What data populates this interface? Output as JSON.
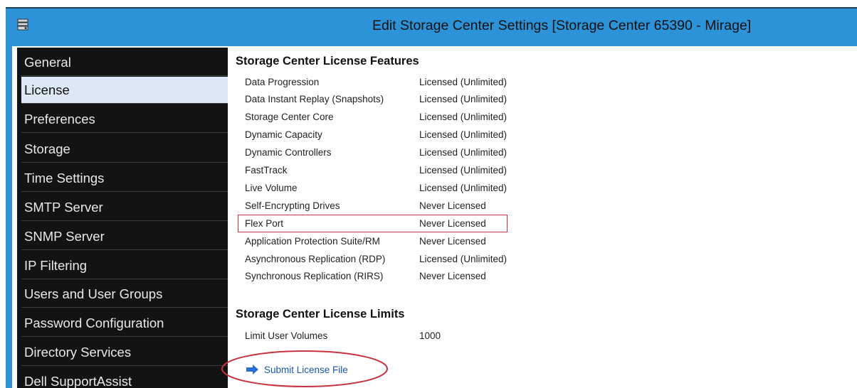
{
  "window": {
    "title": "Edit Storage Center Settings [Storage Center 65390 - Mirage]",
    "icon": "storage-manager-icon"
  },
  "sidebar": {
    "items": [
      {
        "label": "General"
      },
      {
        "label": "License",
        "selected": true
      },
      {
        "label": "Preferences"
      },
      {
        "label": "Storage"
      },
      {
        "label": "Time Settings"
      },
      {
        "label": "SMTP Server"
      },
      {
        "label": "SNMP Server"
      },
      {
        "label": "IP Filtering"
      },
      {
        "label": "Users and User Groups"
      },
      {
        "label": "Password Configuration"
      },
      {
        "label": "Directory Services"
      },
      {
        "label": "Dell SupportAssist"
      }
    ]
  },
  "license_features": {
    "title": "Storage Center License Features",
    "rows": [
      {
        "feature": "Data Progression",
        "status": "Licensed (Unlimited)"
      },
      {
        "feature": "Data Instant Replay (Snapshots)",
        "status": "Licensed (Unlimited)"
      },
      {
        "feature": "Storage Center Core",
        "status": "Licensed (Unlimited)"
      },
      {
        "feature": "Dynamic Capacity",
        "status": "Licensed (Unlimited)"
      },
      {
        "feature": "Dynamic Controllers",
        "status": "Licensed (Unlimited)"
      },
      {
        "feature": "FastTrack",
        "status": "Licensed (Unlimited)"
      },
      {
        "feature": "Live Volume",
        "status": "Licensed (Unlimited)"
      },
      {
        "feature": "Self-Encrypting Drives",
        "status": "Never Licensed"
      },
      {
        "feature": "Flex Port",
        "status": "Never Licensed",
        "highlighted": true
      },
      {
        "feature": "Application Protection Suite/RM",
        "status": "Never Licensed"
      },
      {
        "feature": "Asynchronous Replication (RDP)",
        "status": "Licensed (Unlimited)"
      },
      {
        "feature": "Synchronous Replication (RIRS)",
        "status": "Never Licensed"
      }
    ]
  },
  "license_limits": {
    "title": "Storage Center License Limits",
    "rows": [
      {
        "limit": "Limit User Volumes",
        "value": "1000"
      }
    ]
  },
  "actions": {
    "submit_label": "Submit License File",
    "submit_icon": "arrow-right-icon"
  },
  "colors": {
    "titlebar": "#2d93d8",
    "sidebar_bg": "#131313",
    "selected_bg": "#dce8f5",
    "annotation": "#c8323c",
    "link": "#1a57b0"
  }
}
